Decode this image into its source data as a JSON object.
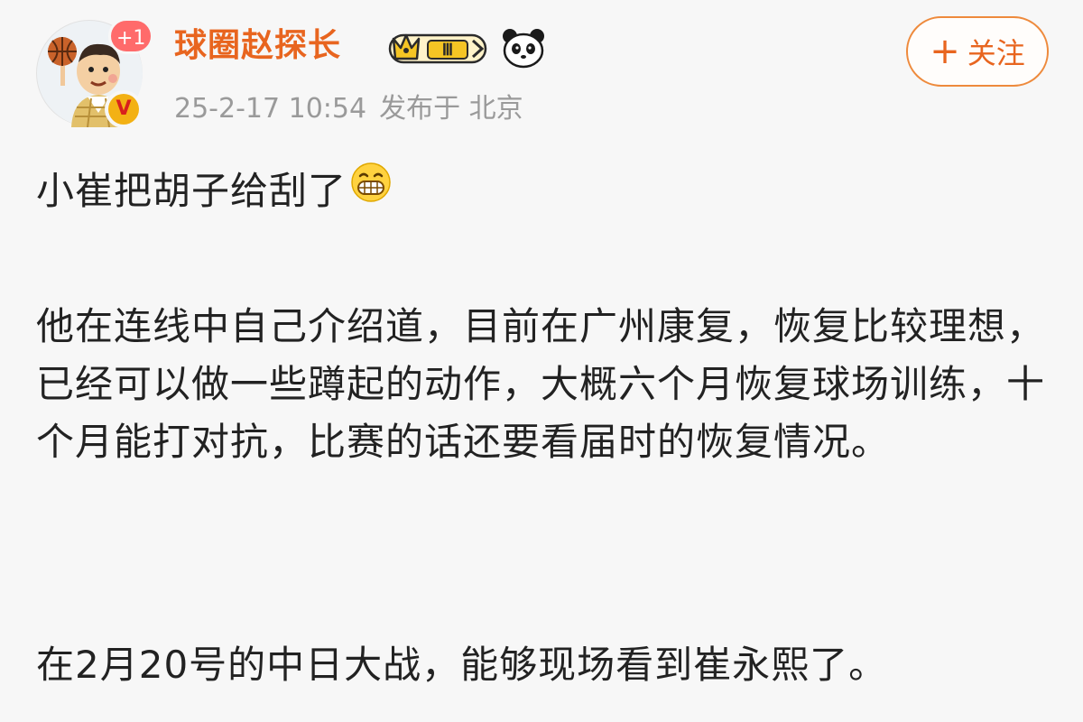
{
  "post": {
    "user": {
      "name": "球圈赵探长",
      "avatar_badge": "+1",
      "verified_mark": "V",
      "level_badge": "Ⅲ"
    },
    "meta": {
      "time": "25-2-17 10:54",
      "location": "发布于 北京"
    },
    "follow_button": {
      "plus": "+",
      "label": "关注"
    },
    "content": {
      "p1": "小崔把胡子给刮了",
      "p2": "他在连线中自己介绍道，目前在广州康复，恢复比较理想，已经可以做一些蹲起的动作，大概六个月恢复球场训练，十个月能打对抗，比赛的话还要看届时的恢复情况。",
      "p3": "在2月20号的中日大战，能够现场看到崔永熙了。"
    }
  },
  "colors": {
    "username": "#e8651f",
    "follow_border": "#ee8a3c",
    "meta": "#9a9a9a",
    "badge_plus": "#ff6b6b",
    "verified": "#f3b114"
  },
  "icons": [
    "avatar-cartoon",
    "verified-icon",
    "crown-level-icon",
    "panda-icon",
    "grin-emoji-icon"
  ]
}
